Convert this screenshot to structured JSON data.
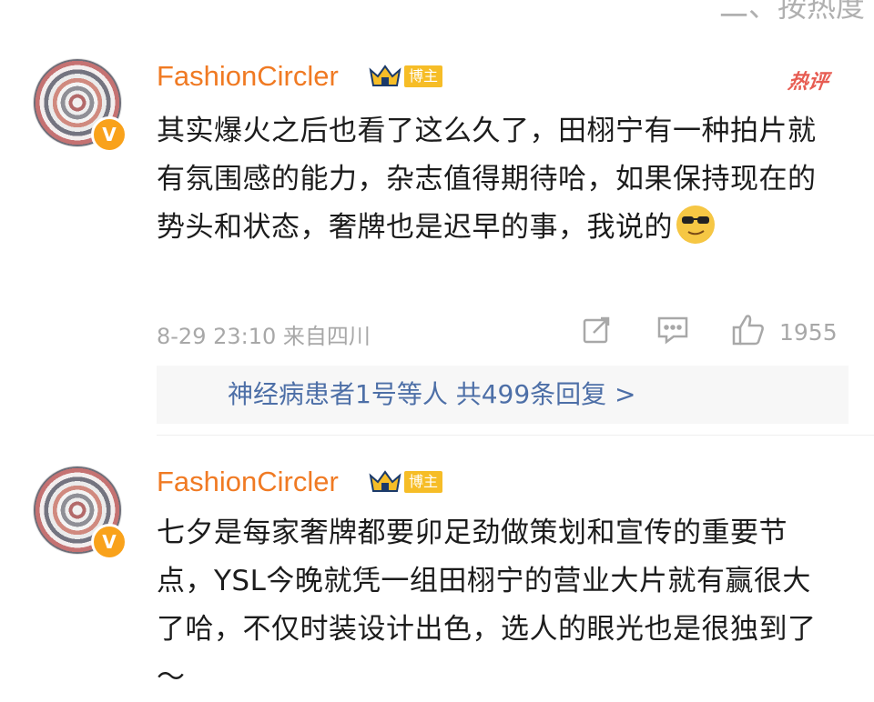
{
  "top": {
    "sort_label": "二、按热度"
  },
  "comments": [
    {
      "username": "FashionCircler",
      "badge": "博主",
      "hot_label": "热评",
      "text": "其实爆火之后也看了这么久了，田栩宁有一种拍片就有氛围感的能力，杂志值得期待哈，如果保持现在的势头和状态，奢牌也是迟早的事，我说的",
      "emoji_name": "cool-sunglasses-emoji",
      "meta": "8-29 23:10  来自四川",
      "likes": "1955",
      "replies_text": "神经病患者1号等人  共499条回复 >"
    },
    {
      "username": "FashionCircler",
      "badge": "博主",
      "text": "七夕是每家奢牌都要卯足劲做策划和宣传的重要节点，YSL今晚就凭一组田栩宁的营业大片就有赢很大了哈，不仅时装设计出色，选人的眼光也是很独到了～"
    }
  ],
  "colors": {
    "username": "#f07a23",
    "badge": "#f6bd27",
    "hot": "#e75c52",
    "reply_link": "#4d6fa7",
    "meta": "#a8a8a8"
  },
  "icons": [
    "crown-icon",
    "vip-v-badge-icon",
    "repost-icon",
    "comment-icon",
    "like-icon"
  ]
}
